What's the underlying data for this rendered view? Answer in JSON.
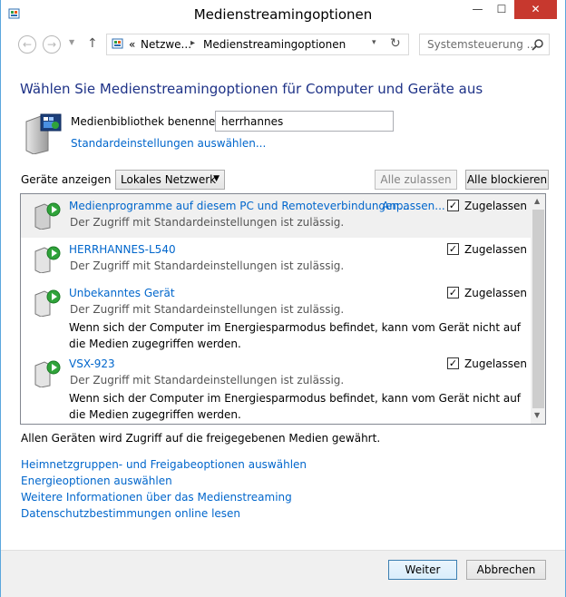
{
  "window": {
    "title": "Medienstreamingoptionen",
    "min_glyph": "—",
    "max_glyph": "☐",
    "close_glyph": "✕"
  },
  "nav": {
    "back_glyph": "←",
    "forward_glyph": "→",
    "up_glyph": "↑",
    "breadcrumb_prefix": "«",
    "breadcrumb_1": "Netzwe...",
    "breadcrumb_separator": "▸",
    "breadcrumb_2": "Medienstreamingoptionen",
    "refresh_glyph": "↻",
    "search_placeholder": "Systemsteuerung ..."
  },
  "heading": "Wählen Sie Medienstreamingoptionen für Computer und Geräte aus",
  "library": {
    "name_label": "Medienbibliothek benennen:",
    "name_value": "herrhannes",
    "defaults_link": "Standardeinstellungen auswählen..."
  },
  "filter": {
    "label": "Geräte anzeigen in:",
    "selected": "Lokales Netzwerk",
    "allow_all": "Alle zulassen",
    "block_all": "Alle blockieren"
  },
  "devices": [
    {
      "name": "Medienprogramme auf diesem PC und Remoteverbindungen...",
      "customize": "Anpassen...",
      "status": "Der Zugriff mit Standardeinstellungen ist zulässig.",
      "note": "",
      "checked": true,
      "check_label": "Zugelassen"
    },
    {
      "name": "HERRHANNES-L540",
      "customize": "",
      "status": "Der Zugriff mit Standardeinstellungen ist zulässig.",
      "note": "",
      "checked": true,
      "check_label": "Zugelassen"
    },
    {
      "name": "Unbekanntes Gerät",
      "customize": "",
      "status": "Der Zugriff mit Standardeinstellungen ist zulässig.",
      "note": "Wenn sich der Computer im Energiesparmodus befindet, kann vom Gerät nicht auf die Medien zugegriffen werden.",
      "checked": true,
      "check_label": "Zugelassen"
    },
    {
      "name": "VSX-923",
      "customize": "",
      "status": "Der Zugriff mit Standardeinstellungen ist zulässig.",
      "note": "Wenn sich der Computer im Energiesparmodus befindet, kann vom Gerät nicht auf die Medien zugegriffen werden.",
      "checked": true,
      "check_label": "Zugelassen"
    }
  ],
  "allow_summary": "Allen Geräten wird Zugriff auf die freigegebenen Medien gewährt.",
  "links": [
    "Heimnetzgruppen- und Freigabeoptionen auswählen",
    "Energieoptionen auswählen",
    "Weitere Informationen über das Medienstreaming",
    "Datenschutzbestimmungen online lesen"
  ],
  "footer": {
    "next": "Weiter",
    "cancel": "Abbrechen"
  },
  "icons": {
    "app": "control-panel-icon",
    "library": "media-server-icon",
    "device": "media-device-icon",
    "search": "search-icon"
  },
  "colors": {
    "heading": "#1e3287",
    "link": "#0066cc",
    "play_badge": "#2fa33a",
    "close_button": "#c7382e"
  }
}
